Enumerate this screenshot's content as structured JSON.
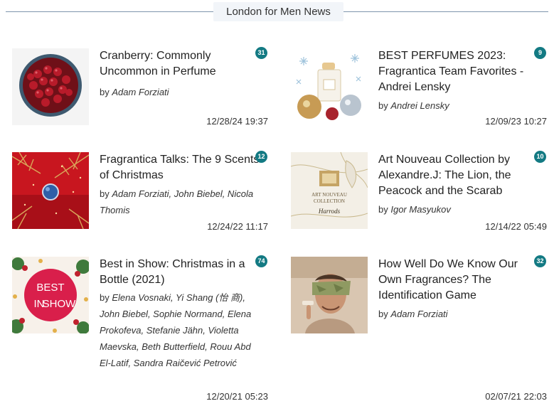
{
  "header": {
    "title": "London for Men News"
  },
  "articles": [
    {
      "title": "Cranberry: Commonly Uncommon in Perfume",
      "by": "by",
      "authors": "Adam Forziati",
      "date": "12/28/24 19:37",
      "comments": "31",
      "thumb_icon": "cranberry-bowl-image"
    },
    {
      "title": "BEST PERFUMES 2023: Fragrantica Team Favorites - Andrei Lensky",
      "by": "by",
      "authors": "Andrei Lensky",
      "date": "12/09/23 10:27",
      "comments": "9",
      "thumb_icon": "perfume-bottle-ornaments-image"
    },
    {
      "title": "Fragrantica Talks: The 9 Scents of Christmas",
      "by": "by",
      "authors": "Adam Forziati, John Biebel, Nicola Thomis",
      "date": "12/24/22 11:17",
      "comments": "12",
      "thumb_icon": "christmas-branches-image"
    },
    {
      "title": "Art Nouveau Collection by Alexandre.J: The Lion, the Peacock and the Scarab",
      "by": "by",
      "authors": "Igor Masyukov",
      "date": "12/14/22 05:49",
      "comments": "10",
      "thumb_icon": "art-nouveau-box-image",
      "thumb_text_1": "ART NOUVEAU",
      "thumb_text_2": "COLLECTION",
      "thumb_text_3": "Harrods"
    },
    {
      "title": "Best in Show: Christmas in a Bottle (2021)",
      "by": "by",
      "authors": "Elena Vosnaki, Yi Shang (怡 商), John Biebel, Sophie Normand, Elena Prokofeva, Stefanie Jähn, Violetta Maevska, Beth Butterfield, Rouu Abd El-Latif, Sandra Raičević Petrović",
      "date": "12/20/21 05:23",
      "comments": "74",
      "thumb_icon": "best-in-show-badge-image",
      "thumb_text_1": "BEST",
      "thumb_text_2": "IN",
      "thumb_text_3": "SHOW"
    },
    {
      "title": "How Well Do We Know Our Own Fragrances? The Identification Game",
      "by": "by",
      "authors": "Adam Forziati",
      "date": "02/07/21 22:03",
      "comments": "32",
      "thumb_icon": "blindfolded-man-image"
    }
  ],
  "colors": {
    "badge": "#137a83",
    "header_bg": "#f2f5f9",
    "rule": "#7f95ad"
  }
}
